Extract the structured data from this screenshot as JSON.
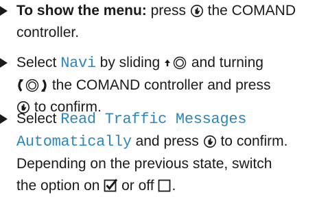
{
  "steps": [
    {
      "lead_bold": "To show the menu:",
      "line1_after_bold": " press ",
      "line1_after_icon": " the COMAND",
      "line2": "controller."
    },
    {
      "select_word": "Select ",
      "menu_item": "Navi",
      "by_sliding": " by sliding ",
      "and_turning": " and turning",
      "line2_after_icon": " the COMAND controller and press",
      "line3_after_icon": " to confirm."
    },
    {
      "select_word": "Select ",
      "option_part1": "Read Traffic Messages",
      "option_part2": "Automatically",
      "and_press": " and press ",
      "to_confirm": " to confirm.",
      "line3": "Depending on the previous state, switch",
      "line4_before": "the option on ",
      "or_off": " or off ",
      "period": "."
    }
  ],
  "icons": {
    "press": "press-controller-icon",
    "slide_up": "slide-up-controller-icon",
    "turn": "turn-controller-icon",
    "checked": "checkbox-checked-icon",
    "unchecked": "checkbox-unchecked-icon"
  },
  "colors": {
    "text": "#1a1a1a",
    "menu_text": "#2f86b8"
  }
}
